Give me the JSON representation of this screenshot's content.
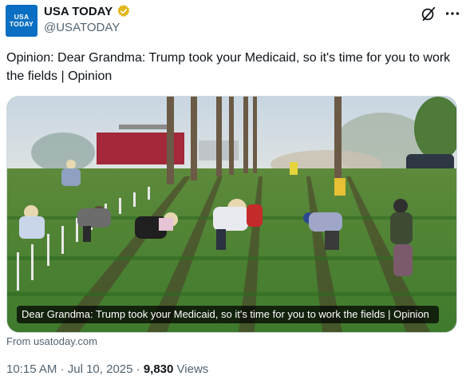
{
  "author": {
    "avatar_line1": "USA",
    "avatar_line2": "TODAY",
    "display_name": "USA TODAY",
    "handle": "@USATODAY",
    "verified_color": "#e2b719"
  },
  "header_icons": [
    "grok-icon",
    "more-icon"
  ],
  "tweet": {
    "text": "Opinion: Dear Grandma: Trump took your Medicaid, so it's time for you to work the fields | Opinion"
  },
  "card": {
    "caption": "Dear Grandma: Trump took your Medicaid, so it's time for you to work the fields | Opinion",
    "source": "From usatoday.com"
  },
  "meta": {
    "time": "10:15 AM",
    "separator": "·",
    "date": "Jul 10, 2025",
    "views_count": "9,830",
    "views_label": "Views"
  },
  "colors": {
    "brand": "#0a6fc2",
    "text_primary": "#0f1419",
    "text_secondary": "#536471"
  }
}
